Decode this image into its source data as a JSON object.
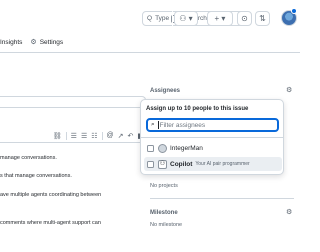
{
  "header": {
    "search_prefix": "Q",
    "search_hint_pre": "Type",
    "search_key": "/",
    "search_hint_post": "to search",
    "command_icon": "command-palette-icon",
    "buttons": [
      {
        "name": "copilot-menu-button",
        "glyph": "⚇ ▾"
      },
      {
        "name": "create-new-button",
        "glyph": "+ ▾"
      },
      {
        "name": "issues-button",
        "glyph": "⊙"
      },
      {
        "name": "pull-requests-button",
        "glyph": "⇅"
      },
      {
        "name": "inbox-button",
        "glyph": "✉"
      }
    ]
  },
  "repo_nav": {
    "insights_label": "Insights",
    "settings_label": "Settings"
  },
  "editor": {
    "toolbar_icons": [
      "link-icon",
      "ordered-list-icon",
      "unordered-list-icon",
      "task-list-icon",
      "mention-icon",
      "reference-icon",
      "undo-icon",
      "slash-command-icon"
    ],
    "lines": [
      "manage conversations.",
      "s that manage conversations.",
      "ave multiple agents coordinating between",
      "comments where multi-agent support can"
    ]
  },
  "sidebar": {
    "assignees_label": "Assignees",
    "projects_value": "No projects",
    "milestone_label": "Milestone",
    "milestone_value": "No milestone"
  },
  "assignee_popover": {
    "title": "Assign up to 10 people to this issue",
    "filter_placeholder": "Filter assignees",
    "options": [
      {
        "name": "IntegerMan",
        "description": "",
        "bold": false,
        "bot": false
      },
      {
        "name": "Copilot",
        "description": "Your AI pair programmer",
        "bold": true,
        "bot": true
      }
    ]
  }
}
